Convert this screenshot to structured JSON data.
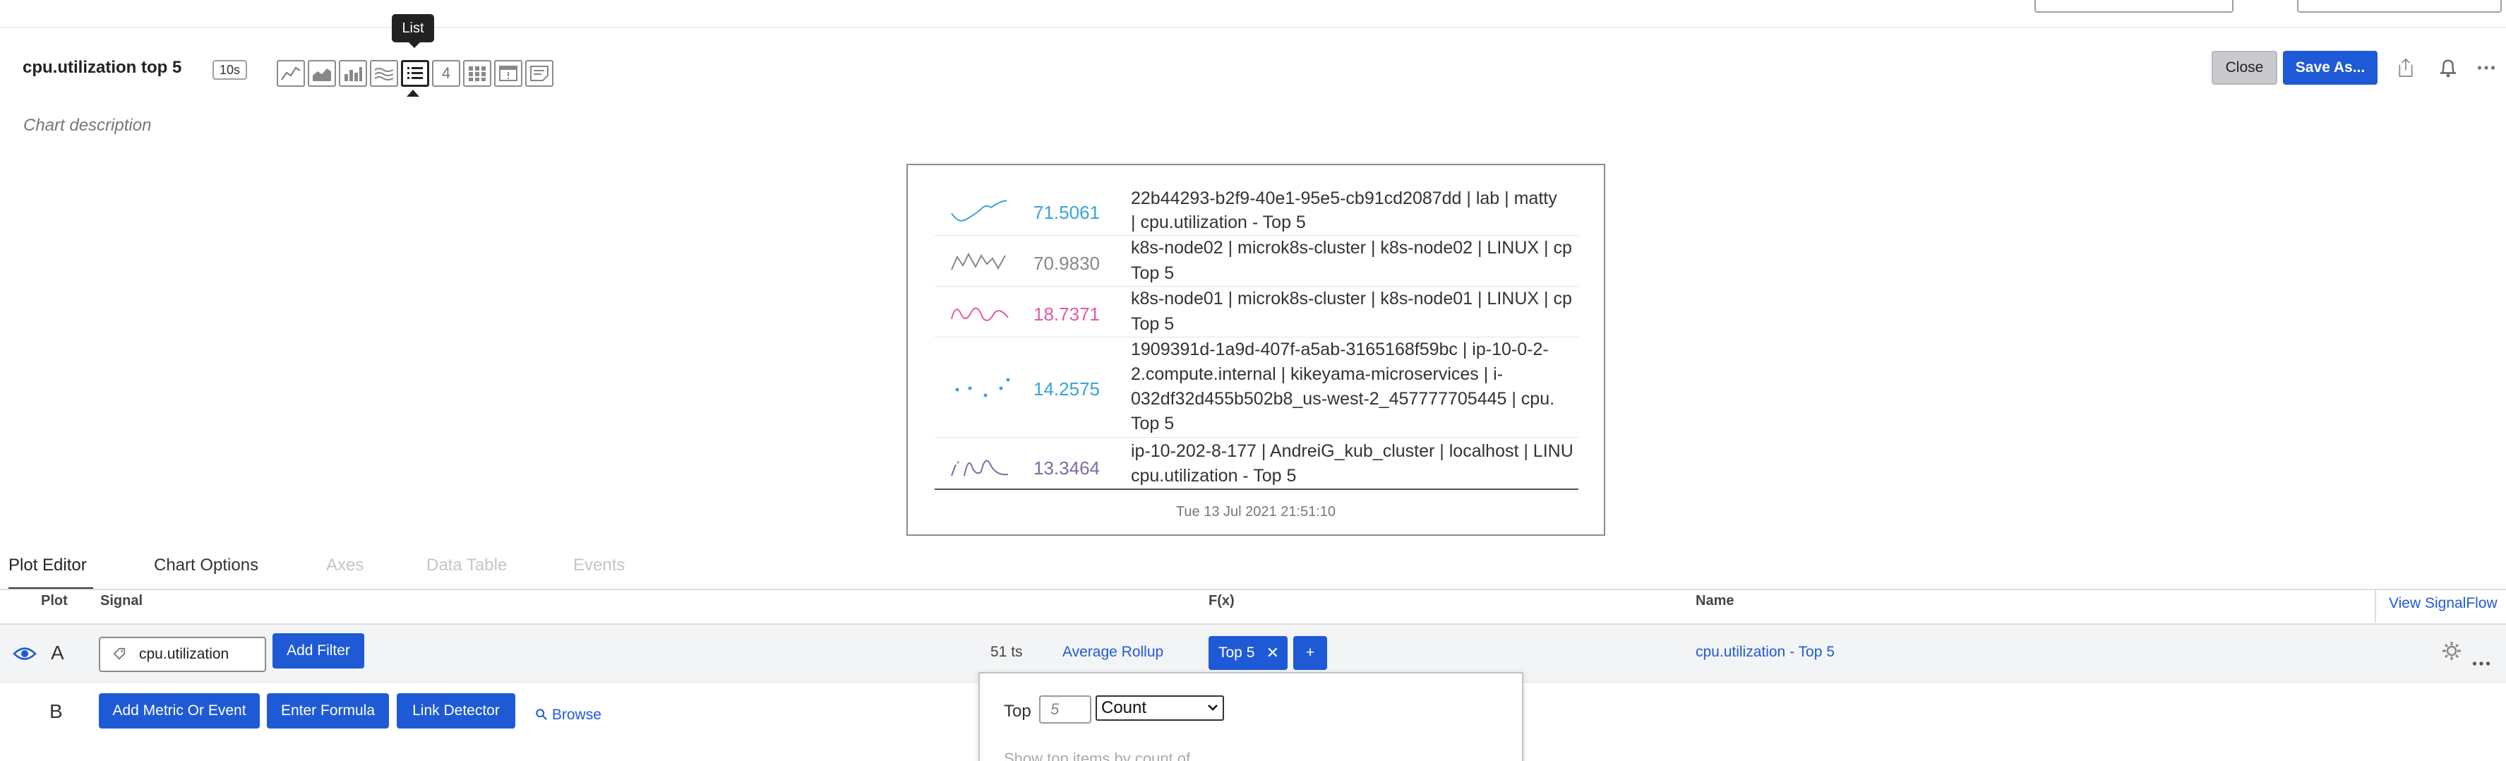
{
  "header": {
    "title": "cpu.utilization top 5",
    "refresh": "10s",
    "description": "Chart description",
    "tooltip": "List",
    "count_icon": "4",
    "close_label": "Close",
    "save_label": "Save As...",
    "chart_types": [
      "line-chart-icon",
      "area-chart-icon",
      "column-chart-icon",
      "histogram-icon",
      "list-icon",
      "single-value-icon",
      "heatmap-icon",
      "event-feed-icon",
      "text-note-icon"
    ]
  },
  "chart": {
    "rows": [
      {
        "value": "71.5061",
        "color": "#3aa3d9",
        "label_1": "22b44293-b2f9-40e1-95e5-cb91cd2087dd | lab | matty",
        "label_2": "| cpu.utilization - Top 5",
        "label_3": "",
        "label_4": ""
      },
      {
        "value": "70.9830",
        "color": "#888888",
        "label_1": "k8s-node02 | microk8s-cluster | k8s-node02 | LINUX | cp",
        "label_2": "Top 5",
        "label_3": "",
        "label_4": ""
      },
      {
        "value": "18.7371",
        "color": "#e45aa3",
        "label_1": "k8s-node01 | microk8s-cluster | k8s-node01 | LINUX | cp",
        "label_2": "Top 5",
        "label_3": "",
        "label_4": ""
      },
      {
        "value": "14.2575",
        "color": "#3aa3d9",
        "label_1": "1909391d-1a9d-407f-a5ab-3165168f59bc | ip-10-0-2-",
        "label_2": "2.compute.internal | kikeyama-microservices | i-",
        "label_3": "032df32d455b502b8_us-west-2_457777705445 | cpu.",
        "label_4": "Top 5"
      },
      {
        "value": "13.3464",
        "color": "#7e6ba6",
        "label_1": "ip-10-202-8-177 | AndreiG_kub_cluster | localhost | LINU",
        "label_2": "cpu.utilization - Top 5",
        "label_3": "",
        "label_4": ""
      }
    ],
    "timestamp": "Tue 13 Jul 2021 21:51:10"
  },
  "tabs": [
    "Plot Editor",
    "Chart Options",
    "Axes",
    "Data Table",
    "Events"
  ],
  "table": {
    "col_plot": "Plot",
    "col_signal": "Signal",
    "col_fx": "F(x)",
    "col_name": "Name",
    "view_signalflow": "View SignalFlow"
  },
  "rowA": {
    "letter": "A",
    "metric": "cpu.utilization",
    "add_filter": "Add Filter",
    "ts_count": "51 ts",
    "rollup": "Average Rollup",
    "fx_chip": "Top 5",
    "fx_add": "+",
    "name": "cpu.utilization - Top 5"
  },
  "rowB": {
    "letter": "B",
    "add_metric": "Add Metric Or Event",
    "enter_formula": "Enter Formula",
    "link_detector": "Link Detector",
    "browse": "Browse"
  },
  "popup": {
    "top_label": "Top",
    "top_placeholder": "5",
    "by_value": "Count",
    "faded_text": "Show top items by count of"
  }
}
